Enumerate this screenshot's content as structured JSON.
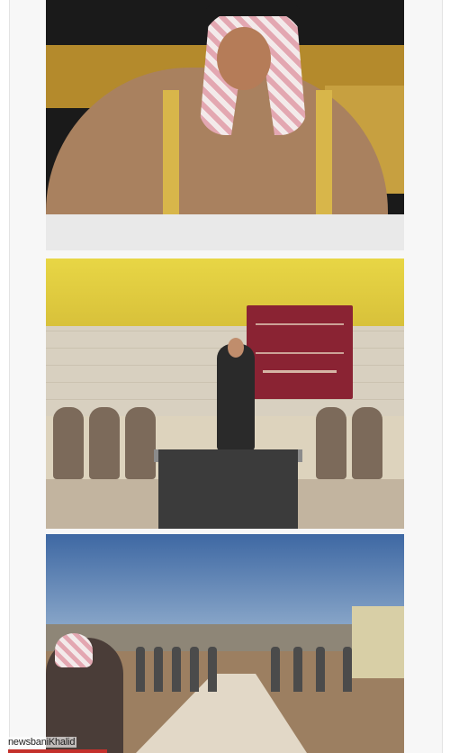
{
  "photos": [
    {
      "subject": "portrait",
      "colors": {
        "headscarf": "#e3a7b1",
        "cloak": "#a9815f"
      }
    },
    {
      "subject": "tent-gathering",
      "colors": {
        "roof": "#e8d645",
        "banner": "#8a2333"
      }
    },
    {
      "subject": "outdoor-crowd",
      "colors": {
        "sky": "#4d73a8",
        "ground": "#9c7f61"
      }
    }
  ],
  "watermark": {
    "text": "newsbaniKhalid",
    "accent": "#c4302b"
  }
}
